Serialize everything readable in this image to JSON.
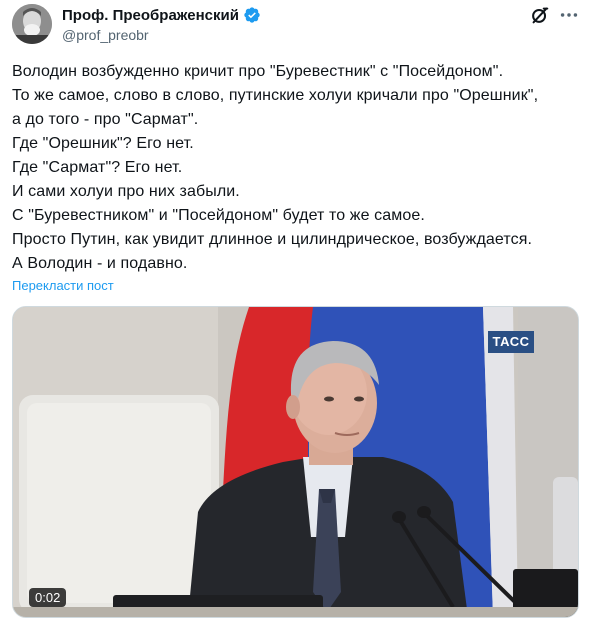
{
  "author": {
    "display_name": "Проф. Преображенский",
    "handle": "@prof_preobr"
  },
  "header_icons": [
    "grok-icon",
    "more-icon"
  ],
  "post": {
    "lines": [
      "Володин возбужденно кричит про \"Буревестник\" с \"Посейдоном\".",
      "То же самое, слово в слово, путинские холуи кричали про \"Орешник\",",
      "а до того - про \"Сармат\".",
      "Где \"Орешник\"? Его нет.",
      "Где \"Сармат\"? Его нет.",
      "И сами холуи про них забыли.",
      "С \"Буревестником\" и \"Посейдоном\" будет то же самое.",
      "Просто Путин, как увидит длинное и цилиндрическое, возбуждается.",
      "А Володин - и подавно."
    ],
    "translate_label": "Перекласти пост"
  },
  "media": {
    "watermark": "ТАСС",
    "duration": "0:02"
  },
  "colors": {
    "accent": "#1d9bf0",
    "text": "#0f1419",
    "secondary": "#536471",
    "tass_blue": "#2a4f84"
  }
}
